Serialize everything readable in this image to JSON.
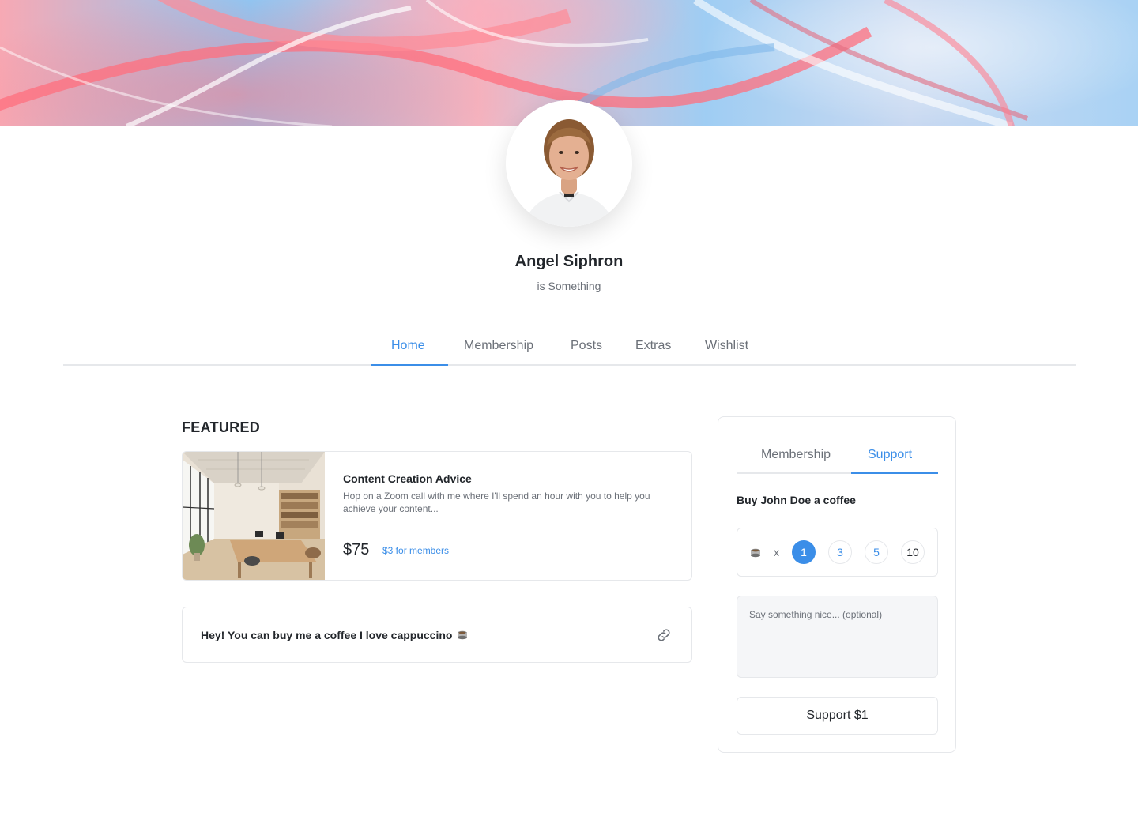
{
  "profile": {
    "name": "Angel Siphron",
    "tagline": "is Something"
  },
  "nav": {
    "tabs": [
      {
        "label": "Home",
        "active": true
      },
      {
        "label": "Membership",
        "active": false
      },
      {
        "label": "Posts",
        "active": false
      },
      {
        "label": "Extras",
        "active": false
      },
      {
        "label": "Wishlist",
        "active": false
      }
    ]
  },
  "featured": {
    "heading": "FEATURED",
    "card": {
      "title": "Content Creation Advice",
      "description": "Hop on a Zoom call with me where I'll spend an hour with you to help you achieve your content...",
      "price": "$75",
      "member_price": "$3 for members"
    },
    "note": {
      "text": "Hey! You can buy me a coffee I love cappuccino"
    }
  },
  "support_panel": {
    "tabs": [
      {
        "label": "Membership",
        "active": false
      },
      {
        "label": "Support",
        "active": true
      }
    ],
    "buy_label": "Buy John Doe a coffee",
    "multiplier": "x",
    "quantities": [
      "1",
      "3",
      "5",
      "10"
    ],
    "selected_quantity": "1",
    "message_placeholder": "Say something nice... (optional)",
    "button_label": "Support $1"
  },
  "colors": {
    "accent": "#3b8ee8",
    "text": "#22262b",
    "muted": "#6b7078",
    "border": "#e6e8eb"
  }
}
